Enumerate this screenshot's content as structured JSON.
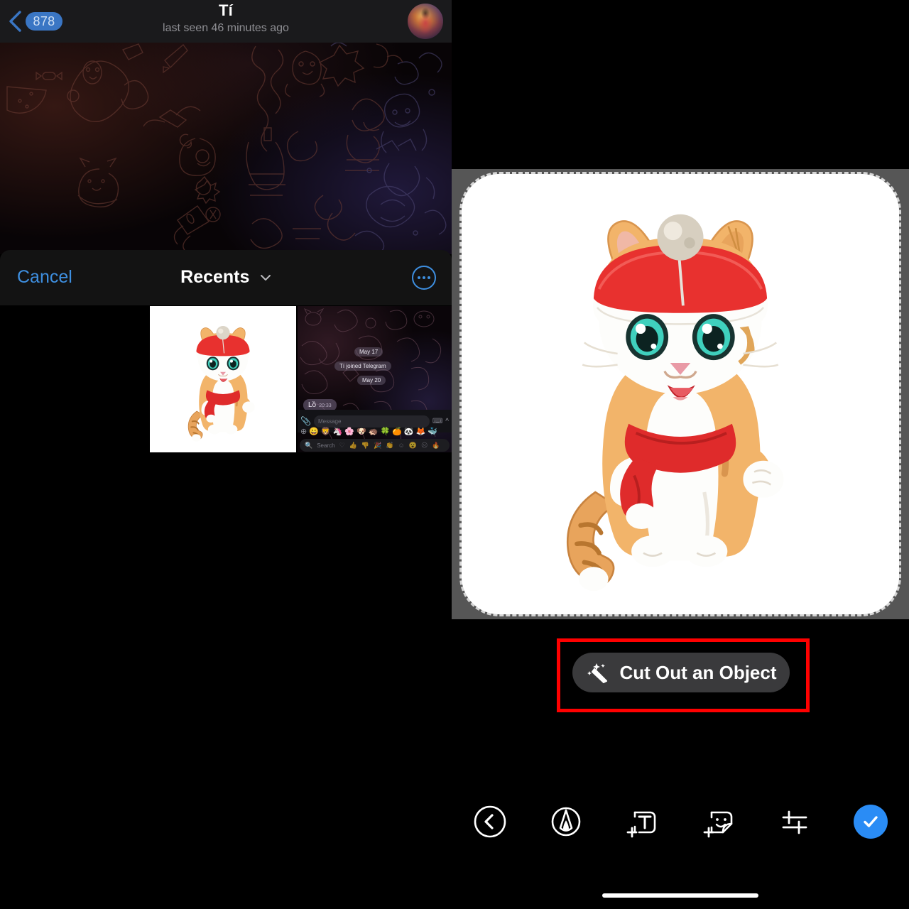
{
  "left_panel": {
    "chat_header": {
      "back_badge": "878",
      "back_icon": "chevron-left-icon",
      "title": "Tí",
      "subtitle": "last seen 46 minutes ago",
      "avatar_icon": "user-avatar",
      "accent_color": "#3a76c4",
      "bg_color": "#1a1a1c"
    },
    "picker": {
      "cancel_label": "Cancel",
      "title": "Recents",
      "chevron_icon": "chevron-down-icon",
      "more_icon": "more-horizontal-icon",
      "link_color": "#3e8fe0",
      "thumbnails": [
        {
          "name": "kitten-photo",
          "kind": "photo"
        },
        {
          "name": "telegram-screenshot",
          "kind": "screenshot"
        }
      ]
    },
    "screenshot_thumb": {
      "date_chip_1": "May 17",
      "service_message": "Tí joined Telegram",
      "date_chip_2": "May 20",
      "bubble_text": "Lồ",
      "bubble_time": "20:33",
      "message_placeholder": "Message",
      "search_placeholder": "Search",
      "attach_icon": "paperclip-icon",
      "keyboard_icon": "keyboard-icon",
      "expand_icon": "chevron-up-icon",
      "plus_icon": "plus-circle-icon",
      "search_icon": "search-icon",
      "reaction_icons": [
        "heart-icon",
        "thumbs-up-icon",
        "thumbs-down-icon",
        "party-icon",
        "clap-icon",
        "smile-icon",
        "shock-icon",
        "sad-icon",
        "fire-icon"
      ]
    }
  },
  "right_panel": {
    "canvas": {
      "bg_color": "#565656",
      "selection_border_color": "#d6d6d6",
      "image_name": "kitten-in-red-hat-and-scarf"
    },
    "cutout": {
      "label": "Cut Out an Object",
      "icon": "magic-wand-icon",
      "highlight_color": "#ff0000",
      "button_color": "#3a3a3c"
    },
    "toolbar": {
      "items": [
        {
          "name": "back-button",
          "icon": "chevron-left-circle-icon"
        },
        {
          "name": "draw-tool",
          "icon": "pen-nib-circle-icon"
        },
        {
          "name": "add-text-tool",
          "icon": "add-text-icon"
        },
        {
          "name": "add-sticker-tool",
          "icon": "add-sticker-icon"
        },
        {
          "name": "adjust-tool",
          "icon": "sliders-icon"
        },
        {
          "name": "done-button",
          "icon": "check-icon"
        }
      ],
      "done_color": "#2a8cf5"
    },
    "home_indicator": "home-indicator-bar"
  }
}
